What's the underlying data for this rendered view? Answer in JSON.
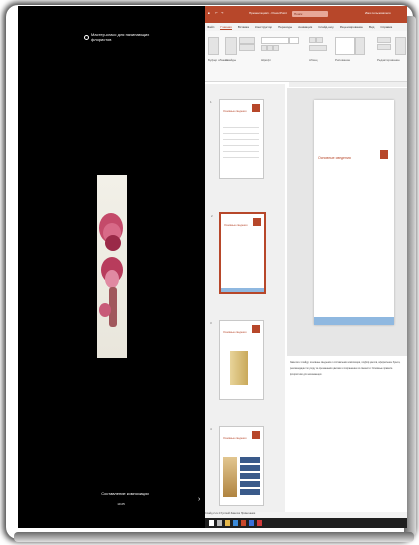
{
  "video": {
    "title": "Мастер-класс для начинающих флористов",
    "caption": "Составление композиции",
    "caption_sub": "10:25",
    "thumb_subject": "red-rose-macro"
  },
  "app": {
    "title": "Презентация1 - PowerPoint",
    "search_placeholder": "Поиск",
    "user": "Имя пользователя",
    "accent": "#b7472a"
  },
  "menu": {
    "items": [
      "Файл",
      "Главная",
      "Вставка",
      "Конструктор",
      "Переходы",
      "Анимация",
      "Слайд-шоу",
      "Рецензирование",
      "Вид",
      "Справка"
    ],
    "active_index": 1
  },
  "ribbon": {
    "groups": [
      "Буфер обмена",
      "Слайды",
      "Шрифт",
      "Абзац",
      "Рисование",
      "Редактирование"
    ]
  },
  "slides": [
    {
      "num": "1",
      "title": "Основные сведения"
    },
    {
      "num": "2",
      "title": "Основные сведения"
    },
    {
      "num": "3",
      "title": "Основные сведения"
    },
    {
      "num": "4",
      "title": "Основные сведения"
    }
  ],
  "current_slide": {
    "title": "Основные сведения"
  },
  "notes": {
    "text": "Заметки к слайду: основные сведения о составлении композиции, подбор цветов, оформление букета, рекомендации по уходу за срезанными цветами и сохранению их свежести. Основные правила флористики для начинающих."
  },
  "status": {
    "text": "Слайд 2 из 4   Русский   Заметки   Примечания"
  },
  "taskbar": {
    "icons": [
      "start-icon",
      "search-icon",
      "explorer-icon",
      "browser-icon",
      "powerpoint-icon",
      "mail-icon",
      "media-icon"
    ]
  }
}
